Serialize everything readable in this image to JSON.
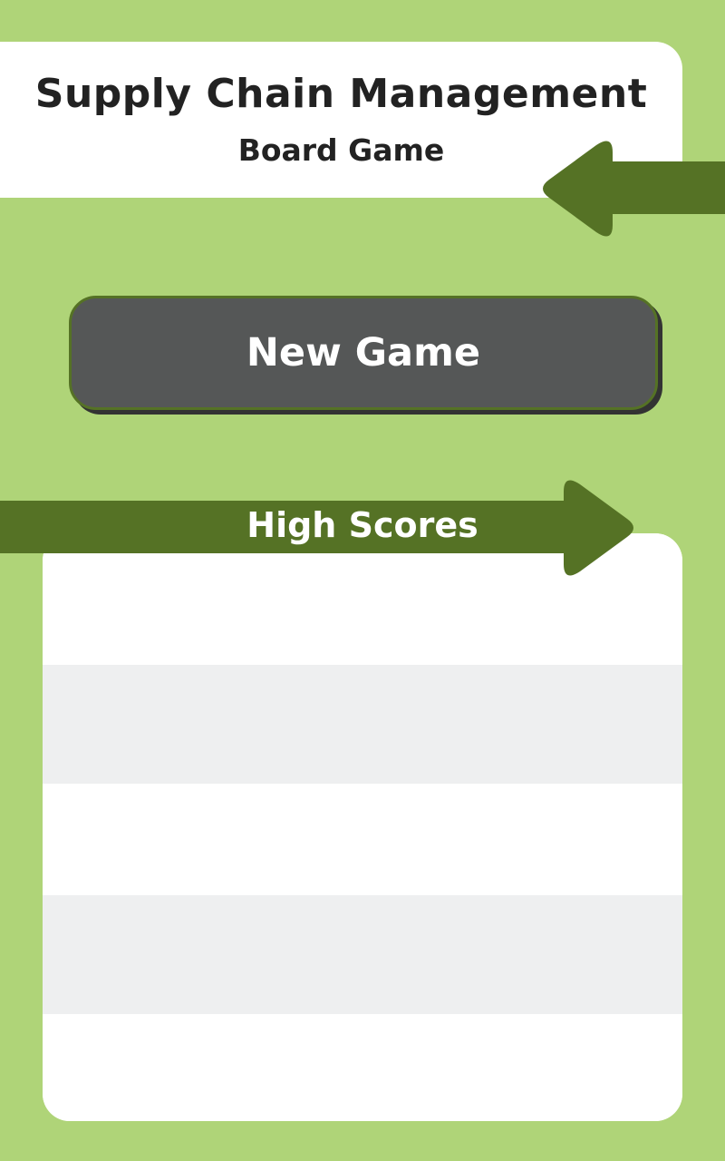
{
  "header": {
    "title": "Supply Chain Management",
    "subtitle": "Board Game"
  },
  "menu": {
    "new_game_label": "New Game"
  },
  "high_scores": {
    "label": "High Scores",
    "rows": [
      {
        "name": "",
        "score": ""
      },
      {
        "name": "",
        "score": ""
      },
      {
        "name": "",
        "score": ""
      },
      {
        "name": "",
        "score": ""
      },
      {
        "name": "",
        "score": ""
      }
    ]
  },
  "colors": {
    "background": "#afd478",
    "arrow": "#557225",
    "button": "#555757",
    "row_alt": "#eeeff0",
    "text_dark": "#222222"
  },
  "icons": {
    "back": "arrow-left-icon",
    "banner": "arrow-right-icon"
  }
}
